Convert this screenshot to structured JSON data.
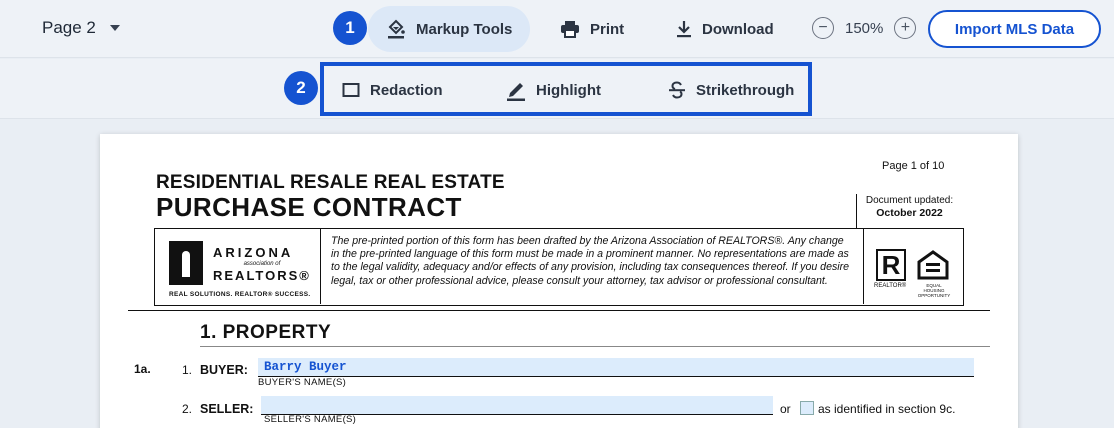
{
  "toolbar": {
    "page_select": "Page 2",
    "badge_1": "1",
    "markup_tools": "Markup Tools",
    "print": "Print",
    "download": "Download",
    "zoom_minus": "−",
    "zoom_level": "150%",
    "zoom_plus": "+",
    "import_mls": "Import MLS Data",
    "icons": [
      "paint-bucket-icon",
      "printer-icon",
      "download-icon",
      "chevron-down-icon"
    ]
  },
  "markup_toolbar": {
    "badge_2": "2",
    "redaction": "Redaction",
    "highlight": "Highlight",
    "strikethrough": "Strikethrough",
    "highlight_color": "#1553d1"
  },
  "document": {
    "page_of": "Page 1 of 10",
    "title_line1": "RESIDENTIAL RESALE REAL ESTATE",
    "title_line2": "PURCHASE CONTRACT",
    "updated_label": "Document updated:",
    "updated_date": "October 2022",
    "logo": {
      "line1": "ARIZONA",
      "line2": "association of",
      "line3": "REALTORS®",
      "tagline": "REAL SOLUTIONS. REALTOR® SUCCESS."
    },
    "disclaimer": "The pre-printed portion of this form has been drafted by the Arizona Association of REALTORS®. Any change in the pre-printed language of this form must be made in a prominent manner. No representations are made as to the legal validity, adequacy and/or effects of any provision, including tax consequences thereof. If you desire legal, tax or other professional advice, please consult your attorney, tax advisor or professional consultant.",
    "realtor_label": "REALTOR®",
    "eho_label": "EQUAL HOUSING OPPORTUNITY",
    "section_title": "1. PROPERTY",
    "section_num": "1a.",
    "buyer": {
      "num": "1.",
      "label": "BUYER:",
      "value": "Barry Buyer",
      "sublabel": "BUYER'S NAME(S)"
    },
    "seller": {
      "num": "2.",
      "label": "SELLER:",
      "value": "",
      "sublabel": "SELLER'S NAME(S)",
      "or_text": "or",
      "identified_text": "as identified in section 9c."
    }
  }
}
